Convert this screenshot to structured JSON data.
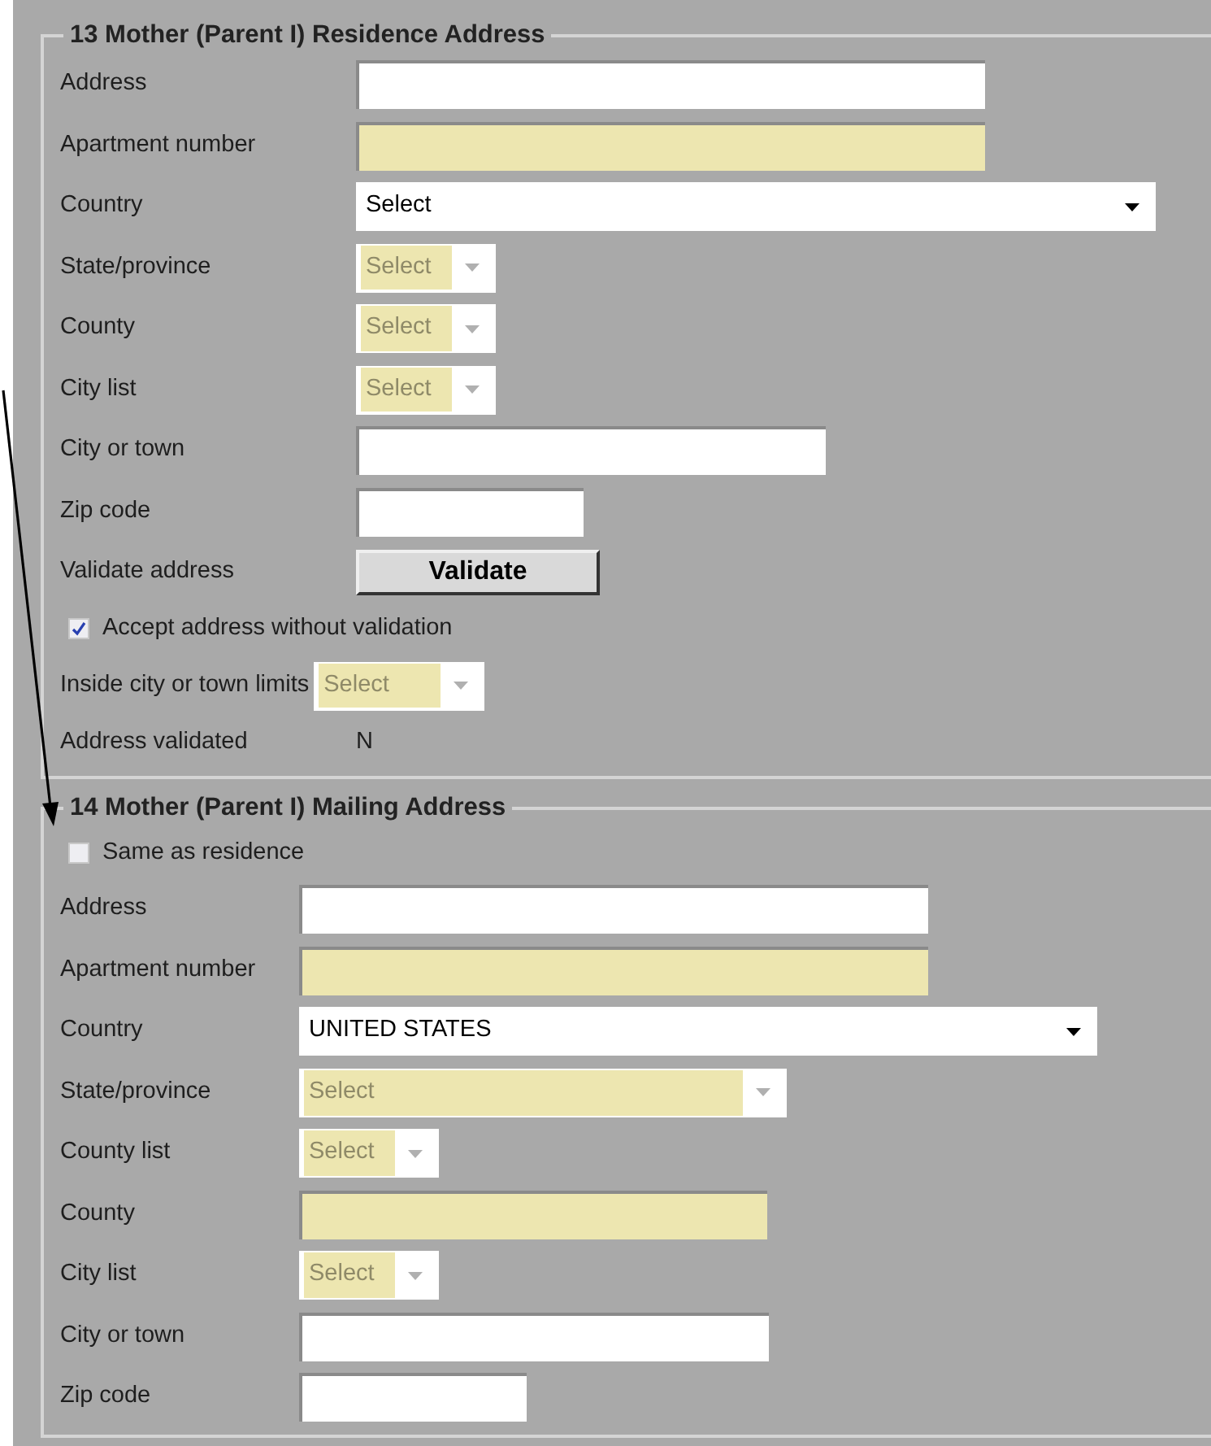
{
  "sections": [
    {
      "title": "13  Mother (Parent I) Residence Address",
      "rows": [
        {
          "kind": "text",
          "label": "Address",
          "highlighted": false
        },
        {
          "kind": "text",
          "label": "Apartment number",
          "highlighted": true
        },
        {
          "kind": "select",
          "label": "Country",
          "value": "Select",
          "disabled": false
        },
        {
          "kind": "select",
          "label": "State/province",
          "value": "Select",
          "disabled": true
        },
        {
          "kind": "select",
          "label": "County",
          "value": "Select",
          "disabled": true
        },
        {
          "kind": "select",
          "label": "City list",
          "value": "Select",
          "disabled": true
        },
        {
          "kind": "text",
          "label": "City or town",
          "highlighted": false
        },
        {
          "kind": "text",
          "label": "Zip code",
          "highlighted": false
        },
        {
          "kind": "button",
          "label": "Validate address",
          "button": "Validate"
        },
        {
          "kind": "checkbox",
          "label": "Accept address without validation",
          "checked": true
        },
        {
          "kind": "inline_select",
          "label": "Inside city or town limits",
          "value": "Select",
          "disabled": true
        },
        {
          "kind": "value",
          "label": "Address validated",
          "value": "N"
        }
      ]
    },
    {
      "title": "14 Mother (Parent I) Mailing Address",
      "rows": [
        {
          "kind": "checkbox",
          "label": "Same as residence",
          "checked": false
        },
        {
          "kind": "text",
          "label": "Address",
          "highlighted": false
        },
        {
          "kind": "text",
          "label": "Apartment number",
          "highlighted": true
        },
        {
          "kind": "select",
          "label": "Country",
          "value": "UNITED STATES",
          "disabled": false
        },
        {
          "kind": "select",
          "label": "State/province",
          "value": "Select",
          "disabled": true
        },
        {
          "kind": "select",
          "label": "County list",
          "value": "Select",
          "disabled": true
        },
        {
          "kind": "text",
          "label": "County",
          "highlighted": true
        },
        {
          "kind": "select",
          "label": "City list",
          "value": "Select",
          "disabled": true
        },
        {
          "kind": "text",
          "label": "City or town",
          "highlighted": false
        },
        {
          "kind": "text",
          "label": "Zip code",
          "highlighted": false
        }
      ]
    }
  ]
}
